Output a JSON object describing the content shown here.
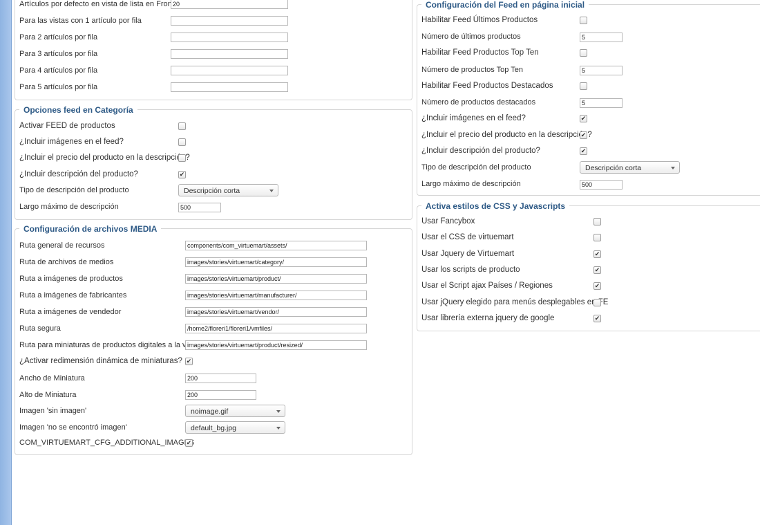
{
  "list_view": {
    "rows": [
      {
        "label": "Artículos por defecto en vista de lista en Frontend",
        "value": "20"
      },
      {
        "label": "Para las vistas con 1 artículo por fila",
        "value": ""
      },
      {
        "label": "Para 2 artículos por fila",
        "value": ""
      },
      {
        "label": "Para 3 artículos por fila",
        "value": ""
      },
      {
        "label": "Para 4 artículos por fila",
        "value": ""
      },
      {
        "label": "Para 5 artículos por fila",
        "value": ""
      }
    ]
  },
  "category_feed": {
    "legend": "Opciones feed en Categoría",
    "enable": {
      "label": "Activar FEED de productos",
      "checked": false
    },
    "images": {
      "label": "¿Incluir imágenes en el feed?",
      "checked": false
    },
    "price": {
      "label": "¿Incluir el precio del producto en la descripción?",
      "checked": false
    },
    "desc": {
      "label": "¿Incluir descripción del producto?",
      "checked": true
    },
    "desc_type": {
      "label": "Tipo de descripción del producto",
      "value": "Descripción corta"
    },
    "max_len": {
      "label": "Largo máximo de descripción",
      "value": "500"
    }
  },
  "media": {
    "legend": "Configuración de archivos MEDIA",
    "paths": [
      {
        "label": "Ruta general de recursos",
        "value": "components/com_virtuemart/assets/"
      },
      {
        "label": "Ruta de archivos de medios",
        "value": "images/stories/virtuemart/category/"
      },
      {
        "label": "Ruta a imágenes de productos",
        "value": "images/stories/virtuemart/product/"
      },
      {
        "label": "Ruta a imágenes de fabricantes",
        "value": "images/stories/virtuemart/manufacturer/"
      },
      {
        "label": "Ruta a imágenes de vendedor",
        "value": "images/stories/virtuemart/vendor/"
      },
      {
        "label": "Ruta segura",
        "value": "/home2/floreri1/floreri1/vmfiles/"
      },
      {
        "label": "Ruta para miniaturas de productos digitales a la venta",
        "value": "images/stories/virtuemart/product/resized/"
      }
    ],
    "resize": {
      "label": "¿Activar redimensión dinámica de miniaturas?",
      "checked": true
    },
    "thumb_width": {
      "label": "Ancho de Miniatura",
      "value": "200"
    },
    "thumb_height": {
      "label": "Alto de Miniatura",
      "value": "200"
    },
    "no_image": {
      "label": "Imagen 'sin imagen'",
      "value": "noimage.gif"
    },
    "not_found": {
      "label": "Imagen 'no se encontró imagen'",
      "value": "default_bg.jpg"
    },
    "additional": {
      "label": "COM_VIRTUEMART_CFG_ADDITIONAL_IMAGES",
      "checked": true
    }
  },
  "home_feed": {
    "legend": "Configuración del Feed en página inicial",
    "latest_enable": {
      "label": "Habilitar Feed Últimos Productos",
      "checked": false
    },
    "latest_num": {
      "label": "Número de últimos productos",
      "value": "5"
    },
    "topten_enable": {
      "label": "Habilitar Feed Productos Top Ten",
      "checked": false
    },
    "topten_num": {
      "label": "Número de productos Top Ten",
      "value": "5"
    },
    "featured_enable": {
      "label": "Habilitar Feed Productos Destacados",
      "checked": false
    },
    "featured_num": {
      "label": "Número de productos destacados",
      "value": "5"
    },
    "images": {
      "label": "¿Incluir imágenes en el feed?",
      "checked": true
    },
    "price": {
      "label": "¿Incluir el precio del producto en la descripción?",
      "checked": true
    },
    "desc": {
      "label": "¿Incluir descripción del producto?",
      "checked": true
    },
    "desc_type": {
      "label": "Tipo de descripción del producto",
      "value": "Descripción corta"
    },
    "max_len": {
      "label": "Largo máximo de descripción",
      "value": "500"
    }
  },
  "css_js": {
    "legend": "Activa estilos de CSS y Javascripts",
    "items": [
      {
        "label": "Usar Fancybox",
        "checked": false
      },
      {
        "label": "Usar el CSS de virtuemart",
        "checked": false
      },
      {
        "label": "Usar Jquery de Virtuemart",
        "checked": true
      },
      {
        "label": "Usar los scripts de producto",
        "checked": true
      },
      {
        "label": "Usar el Script ajax Países / Regiones",
        "checked": true
      },
      {
        "label": "Usar jQuery elegido para menús desplegables en FE",
        "checked": false
      },
      {
        "label": "Usar librería externa jquery de google",
        "checked": true
      }
    ]
  },
  "icons": {
    "check": "check-mark-icon",
    "dropdown": "chevron-down-icon"
  }
}
